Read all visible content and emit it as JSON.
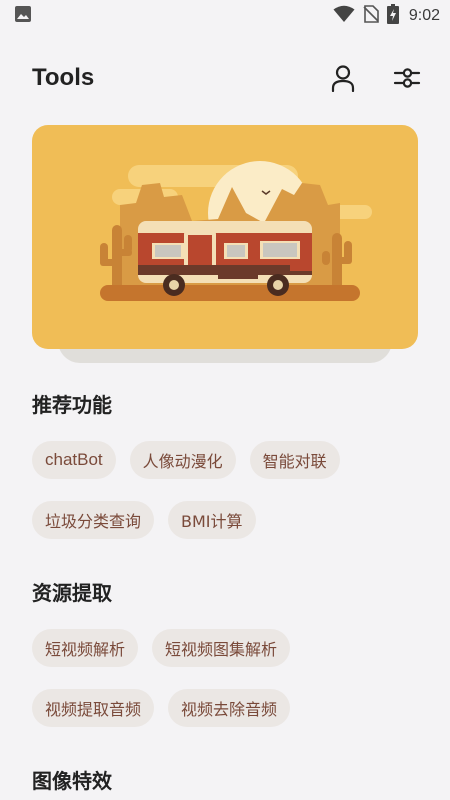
{
  "status_bar": {
    "time": "9:02",
    "icons": [
      "image-icon",
      "wifi-icon",
      "no-sim-icon",
      "battery-charging-icon"
    ]
  },
  "header": {
    "title": "Tools",
    "actions": [
      "profile-icon",
      "settings-sliders-icon"
    ]
  },
  "banner": {
    "illustration": "camper-van-desert-illustration",
    "colors": {
      "background": "#f0bd56",
      "van_red": "#b9472e",
      "van_cream": "#f4dfb6"
    }
  },
  "sections": [
    {
      "title": "推荐功能",
      "rows": [
        [
          "chatBot",
          "人像动漫化",
          "智能对联"
        ],
        [
          "垃圾分类查询",
          "BMI计算"
        ]
      ]
    },
    {
      "title": "资源提取",
      "rows": [
        [
          "短视频解析",
          "短视频图集解析"
        ],
        [
          "视频提取音频",
          "视频去除音频"
        ]
      ]
    },
    {
      "title": "图像特效",
      "rows": []
    }
  ],
  "colors": {
    "page_background": "#f4f3f5",
    "chip_background": "#ebe7e4",
    "chip_text": "#7a4a3a"
  }
}
